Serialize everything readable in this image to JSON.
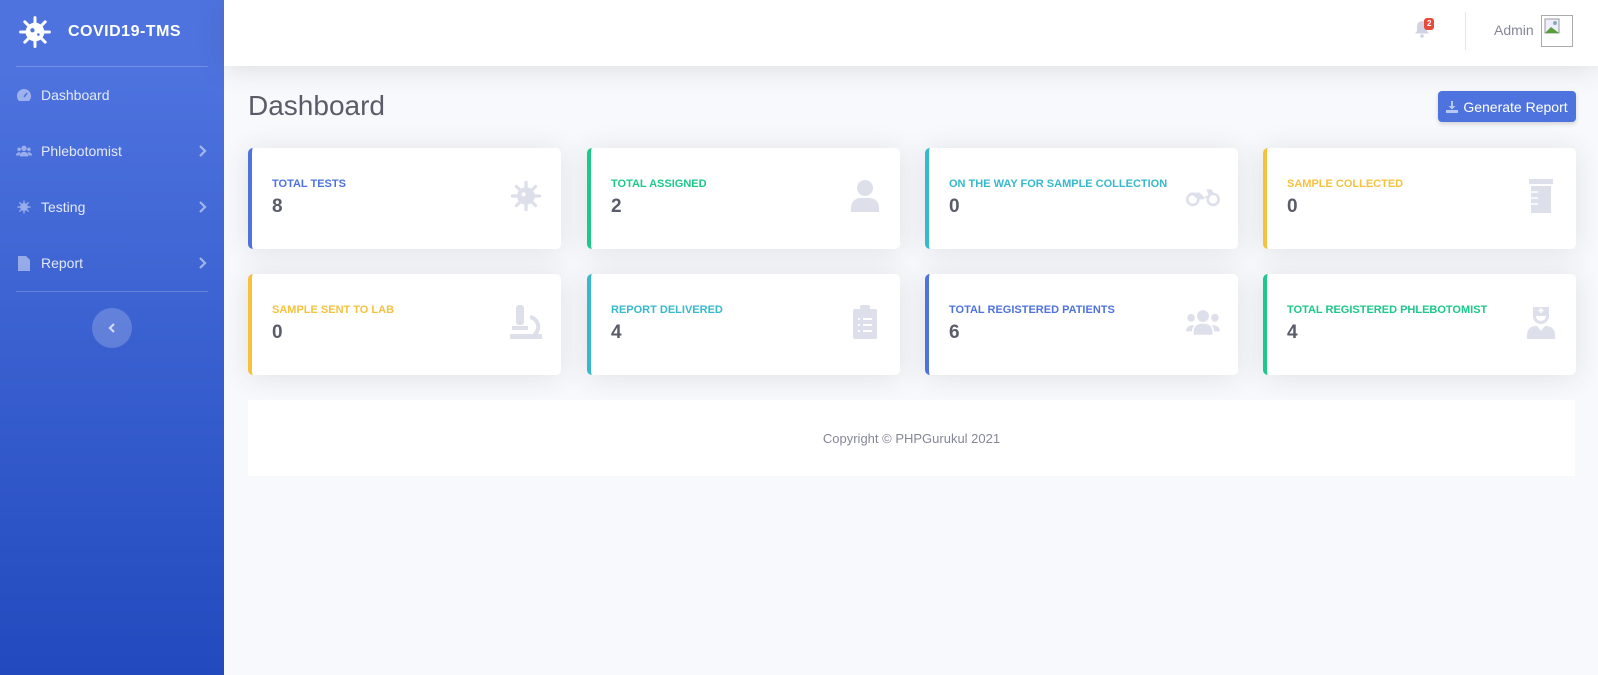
{
  "brand": {
    "name": "COVID19-TMS",
    "icon": "virus-icon"
  },
  "sidebar": {
    "items": [
      {
        "label": "Dashboard",
        "icon": "tachometer-icon",
        "has_submenu": false
      },
      {
        "label": "Phlebotomist",
        "icon": "users-icon",
        "has_submenu": true
      },
      {
        "label": "Testing",
        "icon": "virus-icon",
        "has_submenu": true
      },
      {
        "label": "Report",
        "icon": "file-icon",
        "has_submenu": true
      }
    ],
    "toggle_icon": "chevron-left-icon"
  },
  "topbar": {
    "notifications_count": "2",
    "user_name": "Admin"
  },
  "page": {
    "title": "Dashboard",
    "generate_report_label": "Generate Report"
  },
  "cards": [
    {
      "title": "Total Tests",
      "value": "8",
      "color": "#4e73df",
      "icon": "virus-icon"
    },
    {
      "title": "Total Assigned",
      "value": "2",
      "color": "#1cc88a",
      "icon": "user-icon"
    },
    {
      "title": "On The Way For Sample Collection",
      "value": "0",
      "color": "#36b9cc",
      "icon": "motorcycle-icon"
    },
    {
      "title": "Sample Collected",
      "value": "0",
      "color": "#f6c23e",
      "icon": "vial-icon"
    },
    {
      "title": "Sample Sent To Lab",
      "value": "0",
      "color": "#f6c23e",
      "icon": "microscope-icon"
    },
    {
      "title": "Report Delivered",
      "value": "4",
      "color": "#36b9cc",
      "icon": "clipboard-list-icon"
    },
    {
      "title": "Total Registered Patients",
      "value": "6",
      "color": "#4e73df",
      "icon": "users-icon"
    },
    {
      "title": "Total Registered Phlebotomist",
      "value": "4",
      "color": "#1cc88a",
      "icon": "user-nurse-icon"
    }
  ],
  "footer": {
    "text": "Copyright © PHPGurukul 2021"
  }
}
